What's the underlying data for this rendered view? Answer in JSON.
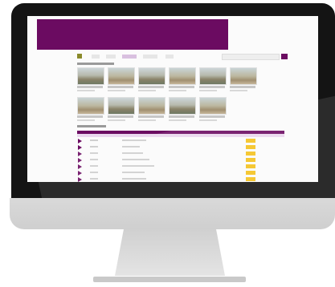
{
  "app": {
    "header_bar_color": "#6b0b61"
  },
  "colors": {
    "accent": "#6b0b61",
    "badge": "#f4c21f",
    "monitor": "#141414"
  },
  "nav": {
    "logo_icon": "logo-icon"
  },
  "gallery": {
    "rows": 2,
    "columns": 6
  },
  "list": {
    "rows": 8,
    "row_icon": "play-icon"
  }
}
